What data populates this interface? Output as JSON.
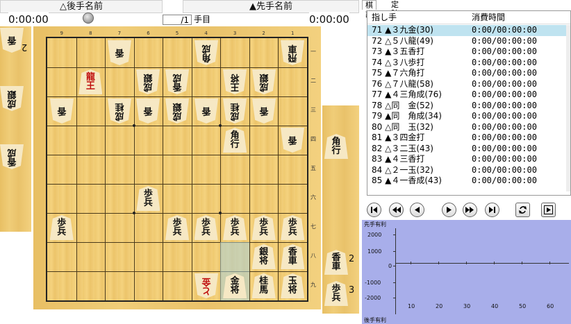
{
  "players": {
    "gote_name": "△後手名前",
    "sente_name": "▲先手名前",
    "gote_time": "0:00:00",
    "sente_time": "0:00:00"
  },
  "move_counter": {
    "value": "/1",
    "unit": "手目"
  },
  "tabs": [
    "棋譜",
    "定跡"
  ],
  "kifu": {
    "col_move": "指し手",
    "col_time": "消費時間",
    "rows": [
      {
        "move": " 71 ▲３九金(30)",
        "time": "0:00/00:00:00",
        "selected": true
      },
      {
        "move": " 72 △５八龍(49)",
        "time": "0:00/00:00:00"
      },
      {
        "move": " 73 ▲３五香打",
        "time": "0:00/00:00:00"
      },
      {
        "move": " 74 △３八歩打",
        "time": "0:00/00:00:00"
      },
      {
        "move": " 75 ▲７六角打",
        "time": "0:00/00:00:00"
      },
      {
        "move": " 76 △７八龍(58)",
        "time": "0:00/00:00:00"
      },
      {
        "move": " 77 ▲４三角成(76)",
        "time": "0:00/00:00:00"
      },
      {
        "move": " 78 △同　金(52)",
        "time": "0:00/00:00:00"
      },
      {
        "move": " 79 ▲同　角成(34)",
        "time": "0:00/00:00:00"
      },
      {
        "move": " 80 △同　玉(32)",
        "time": "0:00/00:00:00"
      },
      {
        "move": " 81 ▲３四金打",
        "time": "0:00/00:00:00"
      },
      {
        "move": " 82 △３二玉(43)",
        "time": "0:00/00:00:00"
      },
      {
        "move": " 83 ▲４三香打",
        "time": "0:00/00:00:00"
      },
      {
        "move": " 84 △２一玉(32)",
        "time": "0:00/00:00:00"
      },
      {
        "move": " 85 ▲４一香成(43)",
        "time": "0:00/00:00:00"
      }
    ]
  },
  "board": {
    "files": [
      "9",
      "8",
      "7",
      "6",
      "5",
      "4",
      "3",
      "2",
      "1"
    ],
    "ranks": [
      "一",
      "二",
      "三",
      "四",
      "五",
      "六",
      "七",
      "八",
      "九"
    ],
    "pieces": [
      {
        "f": 7,
        "r": 1,
        "t": [
          "香"
        ],
        "side": "gote"
      },
      {
        "f": 4,
        "r": 1,
        "t": [
          "角",
          "成"
        ],
        "side": "gote"
      },
      {
        "f": 1,
        "r": 1,
        "t": [
          "飛",
          "車"
        ],
        "side": "gote"
      },
      {
        "f": 8,
        "r": 2,
        "t": [
          "龍",
          "王"
        ],
        "side": "sente",
        "red": true
      },
      {
        "f": 6,
        "r": 2,
        "t": [
          "成",
          "銀"
        ],
        "side": "gote"
      },
      {
        "f": 5,
        "r": 2,
        "t": [
          "香",
          "成"
        ],
        "side": "gote"
      },
      {
        "f": 3,
        "r": 2,
        "t": [
          "王",
          "将"
        ],
        "side": "gote"
      },
      {
        "f": 2,
        "r": 2,
        "t": [
          "成",
          "銀"
        ],
        "side": "gote"
      },
      {
        "f": 9,
        "r": 3,
        "t": [
          "香"
        ],
        "side": "gote"
      },
      {
        "f": 7,
        "r": 3,
        "t": [
          "成",
          "桂"
        ],
        "side": "gote"
      },
      {
        "f": 6,
        "r": 3,
        "t": [
          "香"
        ],
        "side": "gote"
      },
      {
        "f": 5,
        "r": 3,
        "t": [
          "成",
          "銀"
        ],
        "side": "gote"
      },
      {
        "f": 4,
        "r": 3,
        "t": [
          "香"
        ],
        "side": "gote"
      },
      {
        "f": 3,
        "r": 3,
        "t": [
          "成",
          "桂"
        ],
        "side": "gote"
      },
      {
        "f": 2,
        "r": 3,
        "t": [
          "香"
        ],
        "side": "gote"
      },
      {
        "f": 3,
        "r": 4,
        "t": [
          "角",
          "行"
        ],
        "side": "sente"
      },
      {
        "f": 1,
        "r": 4,
        "t": [
          "香"
        ],
        "side": "gote"
      },
      {
        "f": 6,
        "r": 6,
        "t": [
          "歩",
          "兵"
        ],
        "side": "sente"
      },
      {
        "f": 9,
        "r": 7,
        "t": [
          "歩",
          "兵"
        ],
        "side": "sente"
      },
      {
        "f": 5,
        "r": 7,
        "t": [
          "歩",
          "兵"
        ],
        "side": "sente"
      },
      {
        "f": 4,
        "r": 7,
        "t": [
          "歩",
          "兵"
        ],
        "side": "sente"
      },
      {
        "f": 3,
        "r": 7,
        "t": [
          "歩",
          "兵"
        ],
        "side": "sente"
      },
      {
        "f": 2,
        "r": 7,
        "t": [
          "歩",
          "兵"
        ],
        "side": "sente"
      },
      {
        "f": 1,
        "r": 7,
        "t": [
          "歩",
          "兵"
        ],
        "side": "sente"
      },
      {
        "f": 2,
        "r": 8,
        "t": [
          "銀",
          "将"
        ],
        "side": "sente"
      },
      {
        "f": 1,
        "r": 8,
        "t": [
          "香",
          "車"
        ],
        "side": "sente"
      },
      {
        "f": 4,
        "r": 9,
        "t": [
          "と",
          "金"
        ],
        "side": "gote",
        "red": true
      },
      {
        "f": 3,
        "r": 9,
        "t": [
          "金",
          "将"
        ],
        "side": "sente"
      },
      {
        "f": 2,
        "r": 9,
        "t": [
          "桂",
          "馬"
        ],
        "side": "sente"
      },
      {
        "f": 1,
        "r": 9,
        "t": [
          "玉",
          "将"
        ],
        "side": "sente"
      }
    ],
    "highlights": [
      {
        "f": 3,
        "r": 8
      },
      {
        "f": 3,
        "r": 9
      }
    ]
  },
  "gote_hand": [
    {
      "t": [
        "香"
      ],
      "count": "2"
    },
    {
      "t": [
        "成",
        "銀"
      ]
    },
    {
      "t": [
        "香",
        "成"
      ]
    }
  ],
  "sente_hand": [
    {
      "t": [
        "角",
        "行"
      ]
    },
    {
      "t": [
        "香",
        "車"
      ],
      "count": "2"
    },
    {
      "t": [
        "歩",
        "兵"
      ],
      "count": "3"
    }
  ],
  "controls": [
    "first-icon",
    "prev-many-icon",
    "prev-icon",
    "next-icon",
    "next-many-icon",
    "last-icon",
    "rotate-icon",
    "play-icon"
  ],
  "graph": {
    "top_label": "先手有利",
    "bottom_label": "後手有利",
    "y_ticks": [
      "2000",
      "1000",
      "0",
      "-1000",
      "-2000"
    ],
    "x_ticks": [
      "10",
      "20",
      "30",
      "40",
      "50",
      "60"
    ],
    "background": "#a8aeea"
  }
}
